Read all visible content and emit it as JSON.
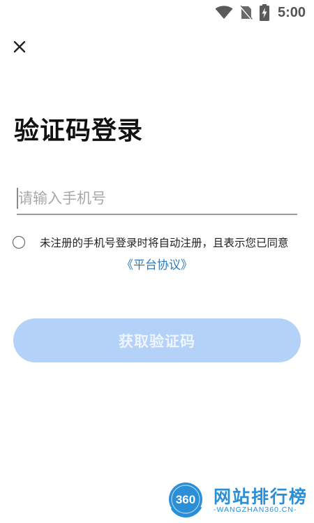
{
  "status_bar": {
    "time": "5:00",
    "icons": [
      "wifi-icon",
      "no-sim-icon",
      "battery-charging-icon"
    ]
  },
  "header": {
    "close_icon": "close-icon"
  },
  "main": {
    "title": "验证码登录",
    "phone_input": {
      "value": "",
      "placeholder": "请输入手机号"
    },
    "agreement": {
      "checked": false,
      "text": "未注册的手机号登录时将自动注册，且表示您已同意",
      "link_label": "《平台协议》"
    },
    "get_code_button": "获取验证码"
  },
  "watermark": {
    "badge_text": "360",
    "title": "网站排行榜",
    "subtitle": "-WANGZHAN360.CN-"
  },
  "colors": {
    "link": "#2e7bbd",
    "button_disabled_bg": "#b4d2f7",
    "watermark": "#2a8fd6"
  }
}
